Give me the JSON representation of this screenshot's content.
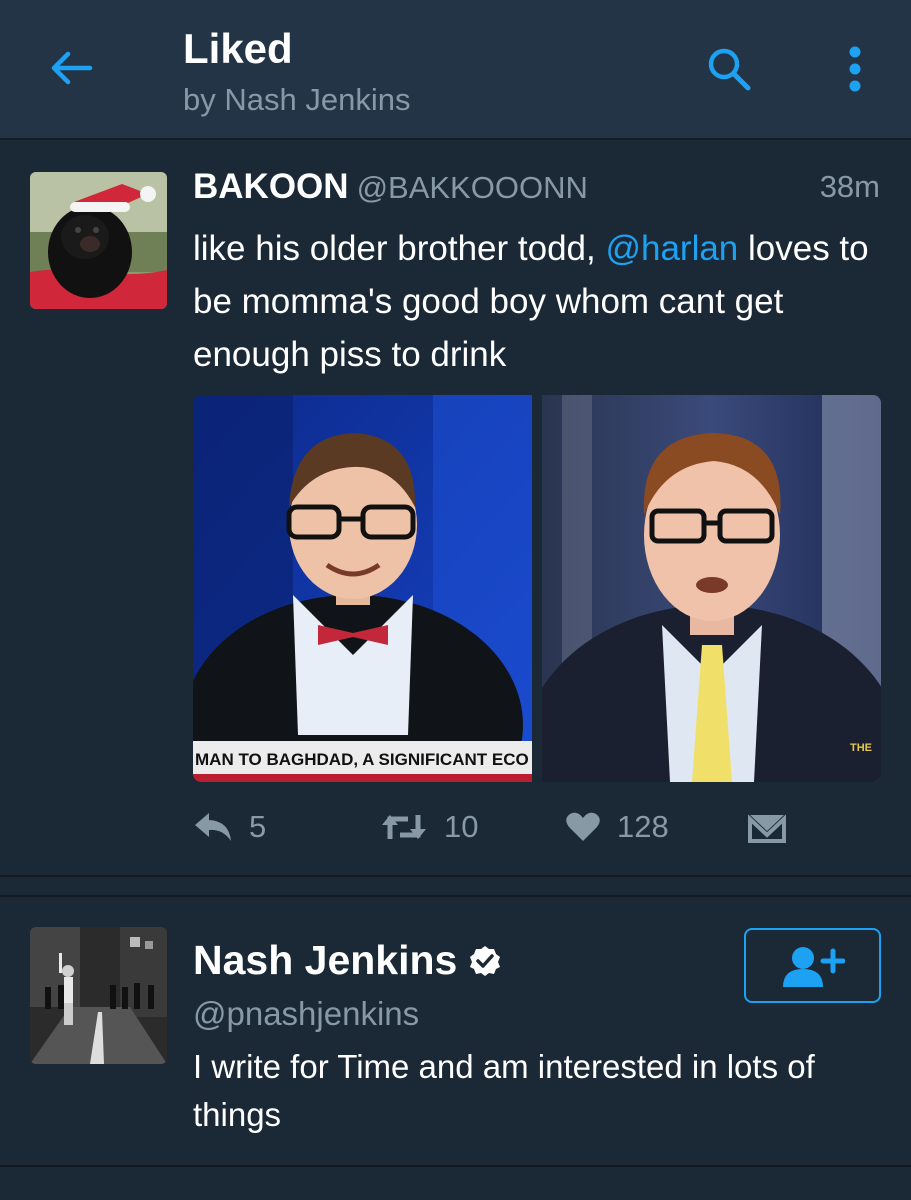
{
  "header": {
    "title": "Liked",
    "subtitle": "by Nash Jenkins",
    "back_icon": "arrow-left-icon",
    "search_icon": "search-icon",
    "more_icon": "more-vertical-icon"
  },
  "tweet": {
    "display_name": "BAKOON",
    "handle": "@BAKKOOONN",
    "timestamp": "38m",
    "text_part1": "like his older brother todd, ",
    "mention": "@harlan",
    "text_part2": " loves to be momma's good boy whom cant get enough piss to drink",
    "media_left_caption": "MAN TO BAGHDAD, A SIGNIFICANT ECO",
    "media_right_caption": "THE",
    "actions": {
      "reply_count": "5",
      "retweet_count": "10",
      "like_count": "128"
    }
  },
  "user_card": {
    "name": "Nash Jenkins",
    "handle": "@pnashjenkins",
    "bio": "I write for Time and am interested in lots of things",
    "follow_icon": "follow-user-icon"
  },
  "colors": {
    "accent": "#1da1f2",
    "background": "#1b2836",
    "header": "#243447",
    "secondary_text": "#8899a6"
  }
}
